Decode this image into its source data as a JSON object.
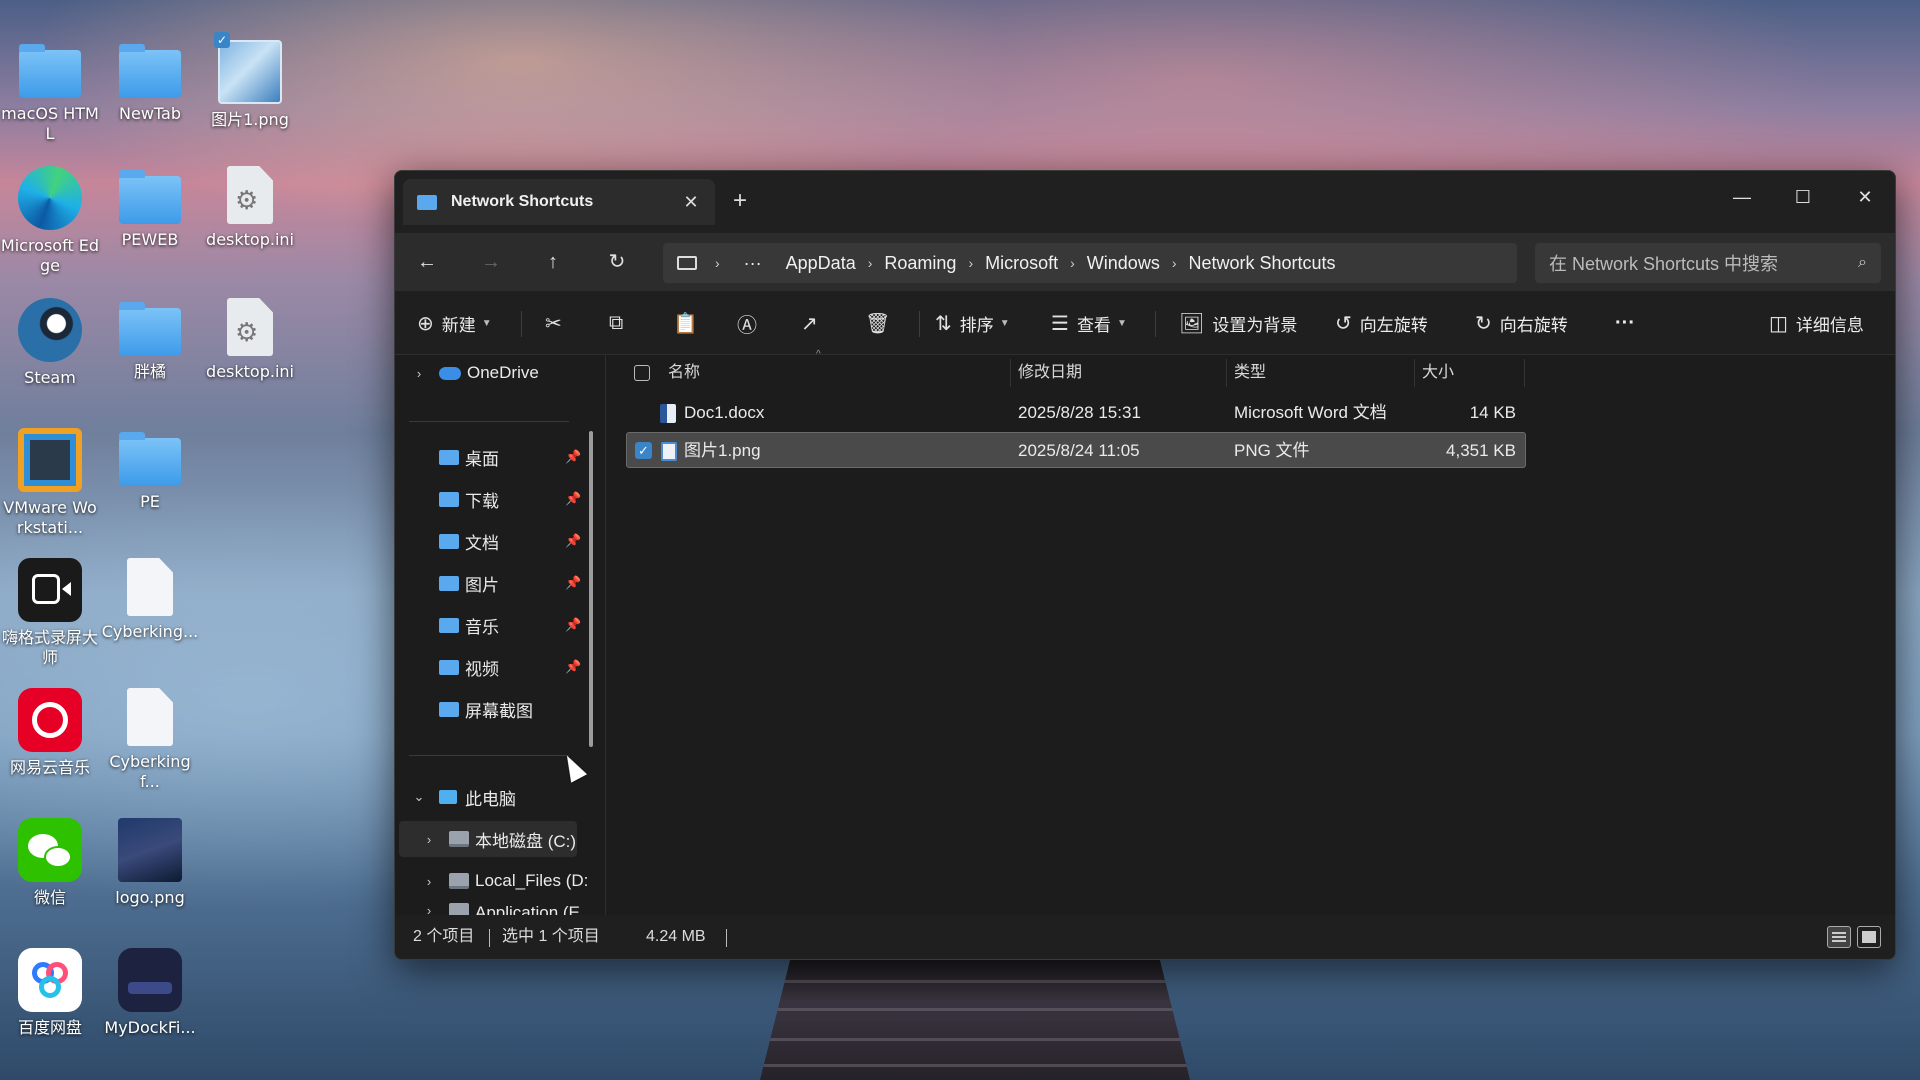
{
  "desktop": {
    "icons": [
      {
        "label": "macOS HTML",
        "icon": "folder"
      },
      {
        "label": "NewTab",
        "icon": "folder"
      },
      {
        "label": "图片1.png",
        "icon": "image-file"
      },
      {
        "label": "Microsoft Edge",
        "icon": "edge"
      },
      {
        "label": "PEWEB",
        "icon": "folder"
      },
      {
        "label": "desktop.ini",
        "icon": "settings-file"
      },
      {
        "label": "Steam",
        "icon": "steam"
      },
      {
        "label": "胖橘",
        "icon": "folder"
      },
      {
        "label": "desktop.ini",
        "icon": "settings-file"
      },
      {
        "label": "VMware Workstati...",
        "icon": "vmware"
      },
      {
        "label": "PE",
        "icon": "folder"
      },
      {
        "label": "嗨格式录屏大师",
        "icon": "screen-recorder"
      },
      {
        "label": "Cyberking...",
        "icon": "file"
      },
      {
        "label": "网易云音乐",
        "icon": "netease-music"
      },
      {
        "label": "Cyberkingf...",
        "icon": "file"
      },
      {
        "label": "微信",
        "icon": "wechat"
      },
      {
        "label": "logo.png",
        "icon": "image-file"
      },
      {
        "label": "百度网盘",
        "icon": "baidu-netdisk"
      },
      {
        "label": "MyDockFi...",
        "icon": "dock-app"
      }
    ]
  },
  "window": {
    "tab_title": "Network Shortcuts",
    "tab_close": "✕",
    "new_tab": "+",
    "controls": {
      "minimize": "—",
      "maximize": "☐",
      "close": "✕"
    },
    "nav": {
      "back": "←",
      "forward": "→",
      "up": "↑",
      "refresh": "↻"
    },
    "breadcrumb": {
      "more": "···",
      "segments": [
        "AppData",
        "Roaming",
        "Microsoft",
        "Windows",
        "Network Shortcuts"
      ]
    },
    "search_placeholder": "在 Network Shortcuts 中搜索",
    "toolbar": {
      "new": "新建",
      "sort": "排序",
      "view": "查看",
      "set_background": "设置为背景",
      "rotate_left": "向左旋转",
      "rotate_right": "向右旋转",
      "more": "···",
      "details": "详细信息"
    },
    "sidebar": {
      "onedrive": "OneDrive",
      "quick_access": [
        {
          "label": "桌面",
          "pinned": true
        },
        {
          "label": "下载",
          "pinned": true
        },
        {
          "label": "文档",
          "pinned": true
        },
        {
          "label": "图片",
          "pinned": true
        },
        {
          "label": "音乐",
          "pinned": true
        },
        {
          "label": "视频",
          "pinned": true
        },
        {
          "label": "屏幕截图",
          "pinned": false
        }
      ],
      "this_pc": "此电脑",
      "drives": [
        "本地磁盘 (C:)",
        "Local_Files (D:",
        "Application (E"
      ]
    },
    "columns": {
      "name": "名称",
      "modified": "修改日期",
      "type": "类型",
      "size": "大小"
    },
    "files": [
      {
        "name": "Doc1.docx",
        "modified": "2025/8/28 15:31",
        "type": "Microsoft Word 文档",
        "size": "14 KB",
        "selected": false,
        "icon": "word-file"
      },
      {
        "name": "图片1.png",
        "modified": "2025/8/24 11:05",
        "type": "PNG 文件",
        "size": "4,351 KB",
        "selected": true,
        "icon": "png-file"
      }
    ],
    "status": {
      "count": "2 个项目",
      "selected": "选中 1 个项目",
      "size": "4.24 MB"
    }
  },
  "colors": {
    "accent": "#3a84c8",
    "folder": "#5aa9ef",
    "window_bg": "#1c1c1c"
  }
}
